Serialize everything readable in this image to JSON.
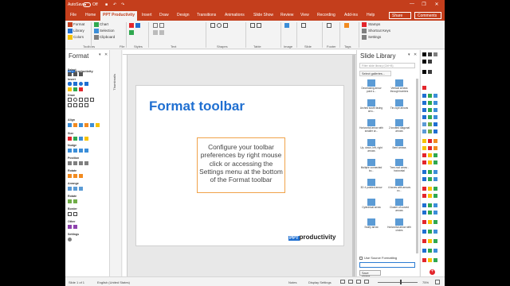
{
  "titlebar": {
    "autosave_label": "AutoSave",
    "autosave_state": "Off",
    "minimize_glyph": "—",
    "restore_glyph": "❐",
    "close_glyph": "✕"
  },
  "tabs": [
    "File",
    "Home",
    "PPT Productivity",
    "Insert",
    "Draw",
    "Design",
    "Transitions",
    "Animations",
    "Slide Show",
    "Review",
    "View",
    "Recording",
    "Add-ins",
    "Help"
  ],
  "active_tab": "PPT Productivity",
  "header_actions": {
    "share": "Share",
    "comments": "Comments"
  },
  "ribbon": {
    "toolbars_group": {
      "items": [
        "Format",
        "Library",
        "Colors"
      ],
      "label": "Toolbars"
    },
    "file_group": {
      "items": [
        "Chart",
        "Selection",
        "Clipboard"
      ],
      "label": "File"
    },
    "group_labels": [
      "Styles",
      "Text",
      "Shapes",
      "Table",
      "Image",
      "Slide",
      "Footer",
      "Tags"
    ],
    "right_items": [
      "Stamps",
      "Shortcut Keys",
      "Settings"
    ]
  },
  "left_panel": {
    "title": "Format",
    "sections": [
      "Select",
      "Insert",
      "Draw",
      "Align",
      "Size",
      "Nudge",
      "Position",
      "Rotate",
      "Arrange",
      "Rotate",
      "Border",
      "Other",
      "Settings"
    ]
  },
  "thumbnails_label": "Thumbnails",
  "slide": {
    "title": "Format toolbar",
    "callout": "Configure your toolbar preferences by right mouse click or accessing the Settings menu at the bottom of the Format toolbar",
    "logo_box": "PPT",
    "logo_text": "productivity"
  },
  "right_panel": {
    "title": "Slide Library",
    "search_placeholder": "Filter slide library (Ctrl+B)",
    "gallery_select": "Select galleries...",
    "items": [
      "Decreasing arrow point s...",
      "Vertical arrows through barriers",
      "Arched south facing arro...",
      "Tie-rope arrows",
      "Horizontal arrow with smaller ar...",
      "2 knotted diagonal arrows",
      "Up, down, left, right arrows",
      "Bent arrows",
      "Multiple connected bo...",
      "Tree-root arrow - horizontal",
      "3D 4 pointed arrow",
      "4 boxes with arrows co...",
      "Cylindrical arrow",
      "Cluster of curved arrows",
      "Swirly arrow",
      "Horizontal arrow with circles"
    ],
    "use_source_formatting": "Use Source Formatting",
    "save_shape": "Save shape..."
  },
  "colors": {
    "accent": "#c43e1c",
    "slide_title": "#1f6fd1",
    "callout_border": "#f0a34a",
    "palette": [
      "#000000",
      "#3b3b3b",
      "#7f7f7f",
      "#1f6fd1",
      "#2fa84f",
      "#3b8ed8",
      "#e3252b",
      "#f6c200",
      "#f28b20",
      "#8e44ad",
      "#5b9bd5",
      "#70ad47"
    ]
  },
  "statusbar": {
    "slide_info": "Slide 1 of 1",
    "language": "English (United States)",
    "notes": "Notes",
    "display_settings": "Display Settings",
    "zoom": "75%"
  }
}
